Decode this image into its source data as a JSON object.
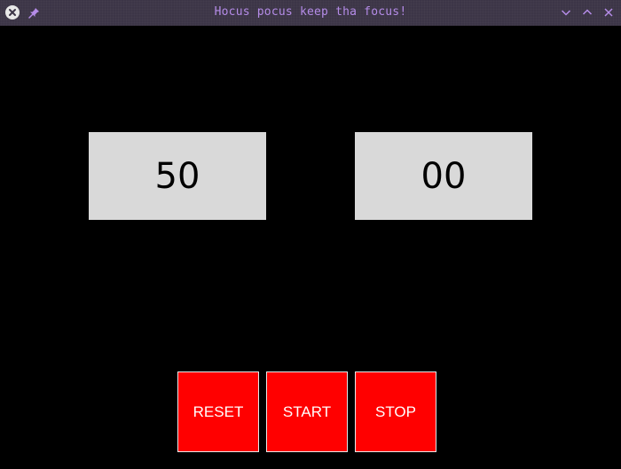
{
  "window": {
    "title": "Hocus pocus keep tha focus!",
    "title_color": "#b58ce8",
    "titlebar_color": "#3c3547",
    "icons": {
      "close": "close-icon",
      "pin": "pin-icon",
      "minimize": "chevron-down-icon",
      "maximize": "chevron-up-icon",
      "dismiss": "x-icon"
    }
  },
  "timer": {
    "minutes": "50",
    "seconds": "00",
    "display_bg": "#d9d9d9"
  },
  "controls": {
    "reset_label": "RESET",
    "start_label": "START",
    "stop_label": "STOP",
    "button_color": "#ff0000"
  }
}
